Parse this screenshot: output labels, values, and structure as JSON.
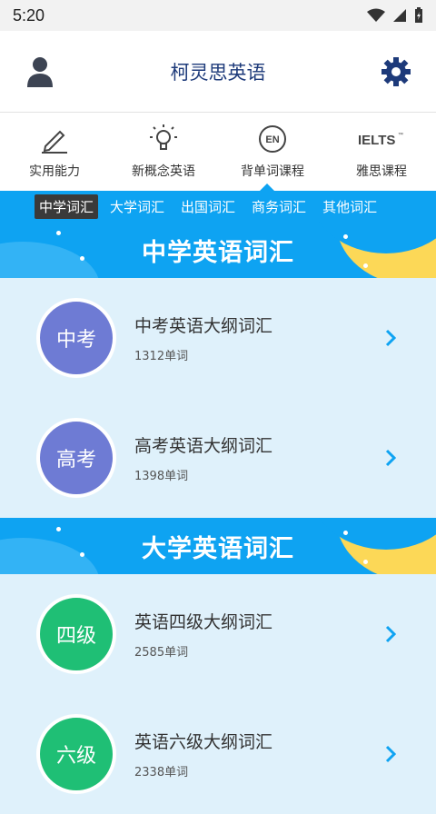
{
  "status": {
    "time": "5:20"
  },
  "header": {
    "title": "柯灵思英语"
  },
  "tabs": [
    {
      "label": "实用能力",
      "icon": "pencil-icon"
    },
    {
      "label": "新概念英语",
      "icon": "lightbulb-icon"
    },
    {
      "label": "背单词课程",
      "icon": "en-icon",
      "icon_text": "EN"
    },
    {
      "label": "雅思课程",
      "icon": "ielts-icon",
      "icon_text": "IELTS",
      "icon_mark": "™"
    }
  ],
  "categories": [
    "中学词汇",
    "大学词汇",
    "出国词汇",
    "商务词汇",
    "其他词汇"
  ],
  "sections": [
    {
      "title": "中学英语词汇",
      "items": [
        {
          "badge": "中考",
          "title": "中考英语大纲词汇",
          "count": "1312单词",
          "color": "purple"
        },
        {
          "badge": "高考",
          "title": "高考英语大纲词汇",
          "count": "1398单词",
          "color": "purple"
        }
      ]
    },
    {
      "title": "大学英语词汇",
      "items": [
        {
          "badge": "四级",
          "title": "英语四级大纲词汇",
          "count": "2585单词",
          "color": "green"
        },
        {
          "badge": "六级",
          "title": "英语六级大纲词汇",
          "count": "2338单词",
          "color": "green"
        }
      ]
    }
  ],
  "colors": {
    "accent": "#0ea3f2",
    "title": "#1d3a7a",
    "purple": "#6e7bd4",
    "green": "#1fbf75",
    "moon": "#fcd857"
  }
}
